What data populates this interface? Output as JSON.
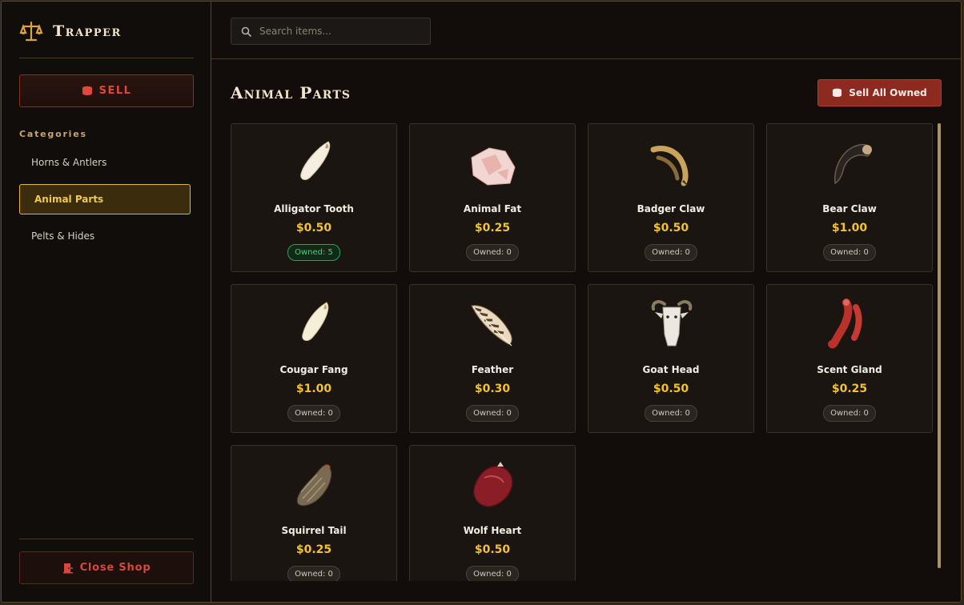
{
  "app": {
    "title": "Trapper"
  },
  "sidebar": {
    "sell_label": "SELL",
    "categories_title": "Categories",
    "categories": [
      {
        "label": "Horns & Antlers",
        "active": false
      },
      {
        "label": "Animal Parts",
        "active": true
      },
      {
        "label": "Pelts & Hides",
        "active": false
      }
    ],
    "close_label": "Close Shop"
  },
  "search": {
    "placeholder": "Search items..."
  },
  "section": {
    "title": "Animal Parts",
    "sell_all_label": "Sell All Owned"
  },
  "items": [
    {
      "name": "Alligator Tooth",
      "price": "$0.50",
      "owned": "Owned: 5",
      "has_owned": true,
      "icon": "tooth-icon"
    },
    {
      "name": "Animal Fat",
      "price": "$0.25",
      "owned": "Owned: 0",
      "has_owned": false,
      "icon": "fat-icon"
    },
    {
      "name": "Badger Claw",
      "price": "$0.50",
      "owned": "Owned: 0",
      "has_owned": false,
      "icon": "claw-icon"
    },
    {
      "name": "Bear Claw",
      "price": "$1.00",
      "owned": "Owned: 0",
      "has_owned": false,
      "icon": "bear-claw-icon"
    },
    {
      "name": "Cougar Fang",
      "price": "$1.00",
      "owned": "Owned: 0",
      "has_owned": false,
      "icon": "fang-icon"
    },
    {
      "name": "Feather",
      "price": "$0.30",
      "owned": "Owned: 0",
      "has_owned": false,
      "icon": "feather-icon"
    },
    {
      "name": "Goat Head",
      "price": "$0.50",
      "owned": "Owned: 0",
      "has_owned": false,
      "icon": "goat-head-icon"
    },
    {
      "name": "Scent Gland",
      "price": "$0.25",
      "owned": "Owned: 0",
      "has_owned": false,
      "icon": "gland-icon"
    },
    {
      "name": "Squirrel Tail",
      "price": "$0.25",
      "owned": "Owned: 0",
      "has_owned": false,
      "icon": "tail-icon"
    },
    {
      "name": "Wolf Heart",
      "price": "$0.50",
      "owned": "Owned: 0",
      "has_owned": false,
      "icon": "heart-icon"
    }
  ],
  "colors": {
    "accent_gold": "#f1c232",
    "accent_red": "#8c2a20",
    "owned_green": "#46d27a"
  }
}
